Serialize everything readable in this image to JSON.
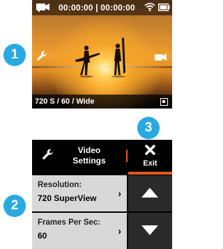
{
  "preview": {
    "timecode": "00:00:00 | 00:00:00",
    "mode_summary": "720 S / 60 / Wide",
    "icons": [
      "video-camera-icon",
      "wifi-icon",
      "battery-icon",
      "wrench-icon",
      "mode-icon",
      "expand-icon"
    ]
  },
  "callouts": [
    "1",
    "2",
    "3"
  ],
  "settings_menu": {
    "title_line1": "Video",
    "title_line2": "Settings",
    "exit_label": "Exit",
    "accent_color": "#e55a1c",
    "items": [
      {
        "label": "Resolution:",
        "value": "720 SuperView"
      },
      {
        "label": "Frames Per Sec:",
        "value": "60"
      }
    ],
    "scroll_buttons": [
      "up-arrow-icon",
      "down-arrow-icon"
    ]
  },
  "colors": {
    "callout_blue": "#29a9e1",
    "menu_item_bg": "#d8d8d8",
    "button_bg": "#2a2a2a"
  }
}
